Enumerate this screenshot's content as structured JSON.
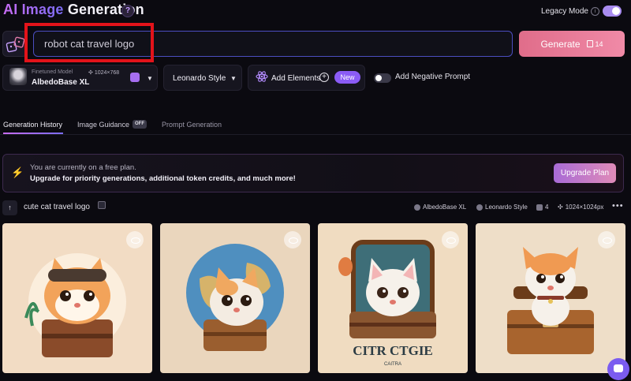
{
  "header": {
    "title_accent": "AI Image",
    "title_rest": " Generation",
    "legacy_mode_label": "Legacy Mode",
    "help_glyph": "?",
    "info_glyph": "i"
  },
  "prompt": {
    "value": "robot cat travel logo"
  },
  "generate": {
    "label": "Generate",
    "token_cost": "14"
  },
  "model": {
    "subtitle": "Finetuned Model",
    "resolution": "1024×768",
    "name": "AlbedoBase XL"
  },
  "style": {
    "label": "Leonardo Style"
  },
  "elements": {
    "label": "Add Elements",
    "badge": "New",
    "plus": "+"
  },
  "negative_prompt": {
    "label": "Add Negative Prompt"
  },
  "tabs": [
    {
      "label": "Generation History"
    },
    {
      "label": "Image Guidance",
      "badge": "OFF"
    },
    {
      "label": "Prompt Generation"
    }
  ],
  "banner": {
    "line1": "You are currently on a free plan.",
    "line2": "Upgrade for priority generations, additional token credits, and much more!",
    "button": "Upgrade Plan",
    "bolt": "⚡"
  },
  "generation": {
    "title": "cute cat travel logo",
    "arrow": "↑",
    "model": "AlbedoBase XL",
    "style": "Leonardo Style",
    "count": "4",
    "size": "1024×1024px",
    "more": "•••"
  },
  "images": [
    {
      "name": "cat-with-suitcase-and-palm",
      "bg": "#f2dcc4"
    },
    {
      "name": "cat-with-globe-and-suitcase",
      "bg": "#ead6bd"
    },
    {
      "name": "cat-in-suitcase-logo",
      "bg": "#f0dcc1",
      "caption": "CITR CTGIE",
      "caption_sub": "CAITRA"
    },
    {
      "name": "cat-sitting-in-suitcase",
      "bg": "#eedec8"
    }
  ],
  "colors": {
    "accent": "#8b5cf6",
    "generate_gradient_start": "#e06d8a",
    "highlight_box": "#e3131a"
  }
}
